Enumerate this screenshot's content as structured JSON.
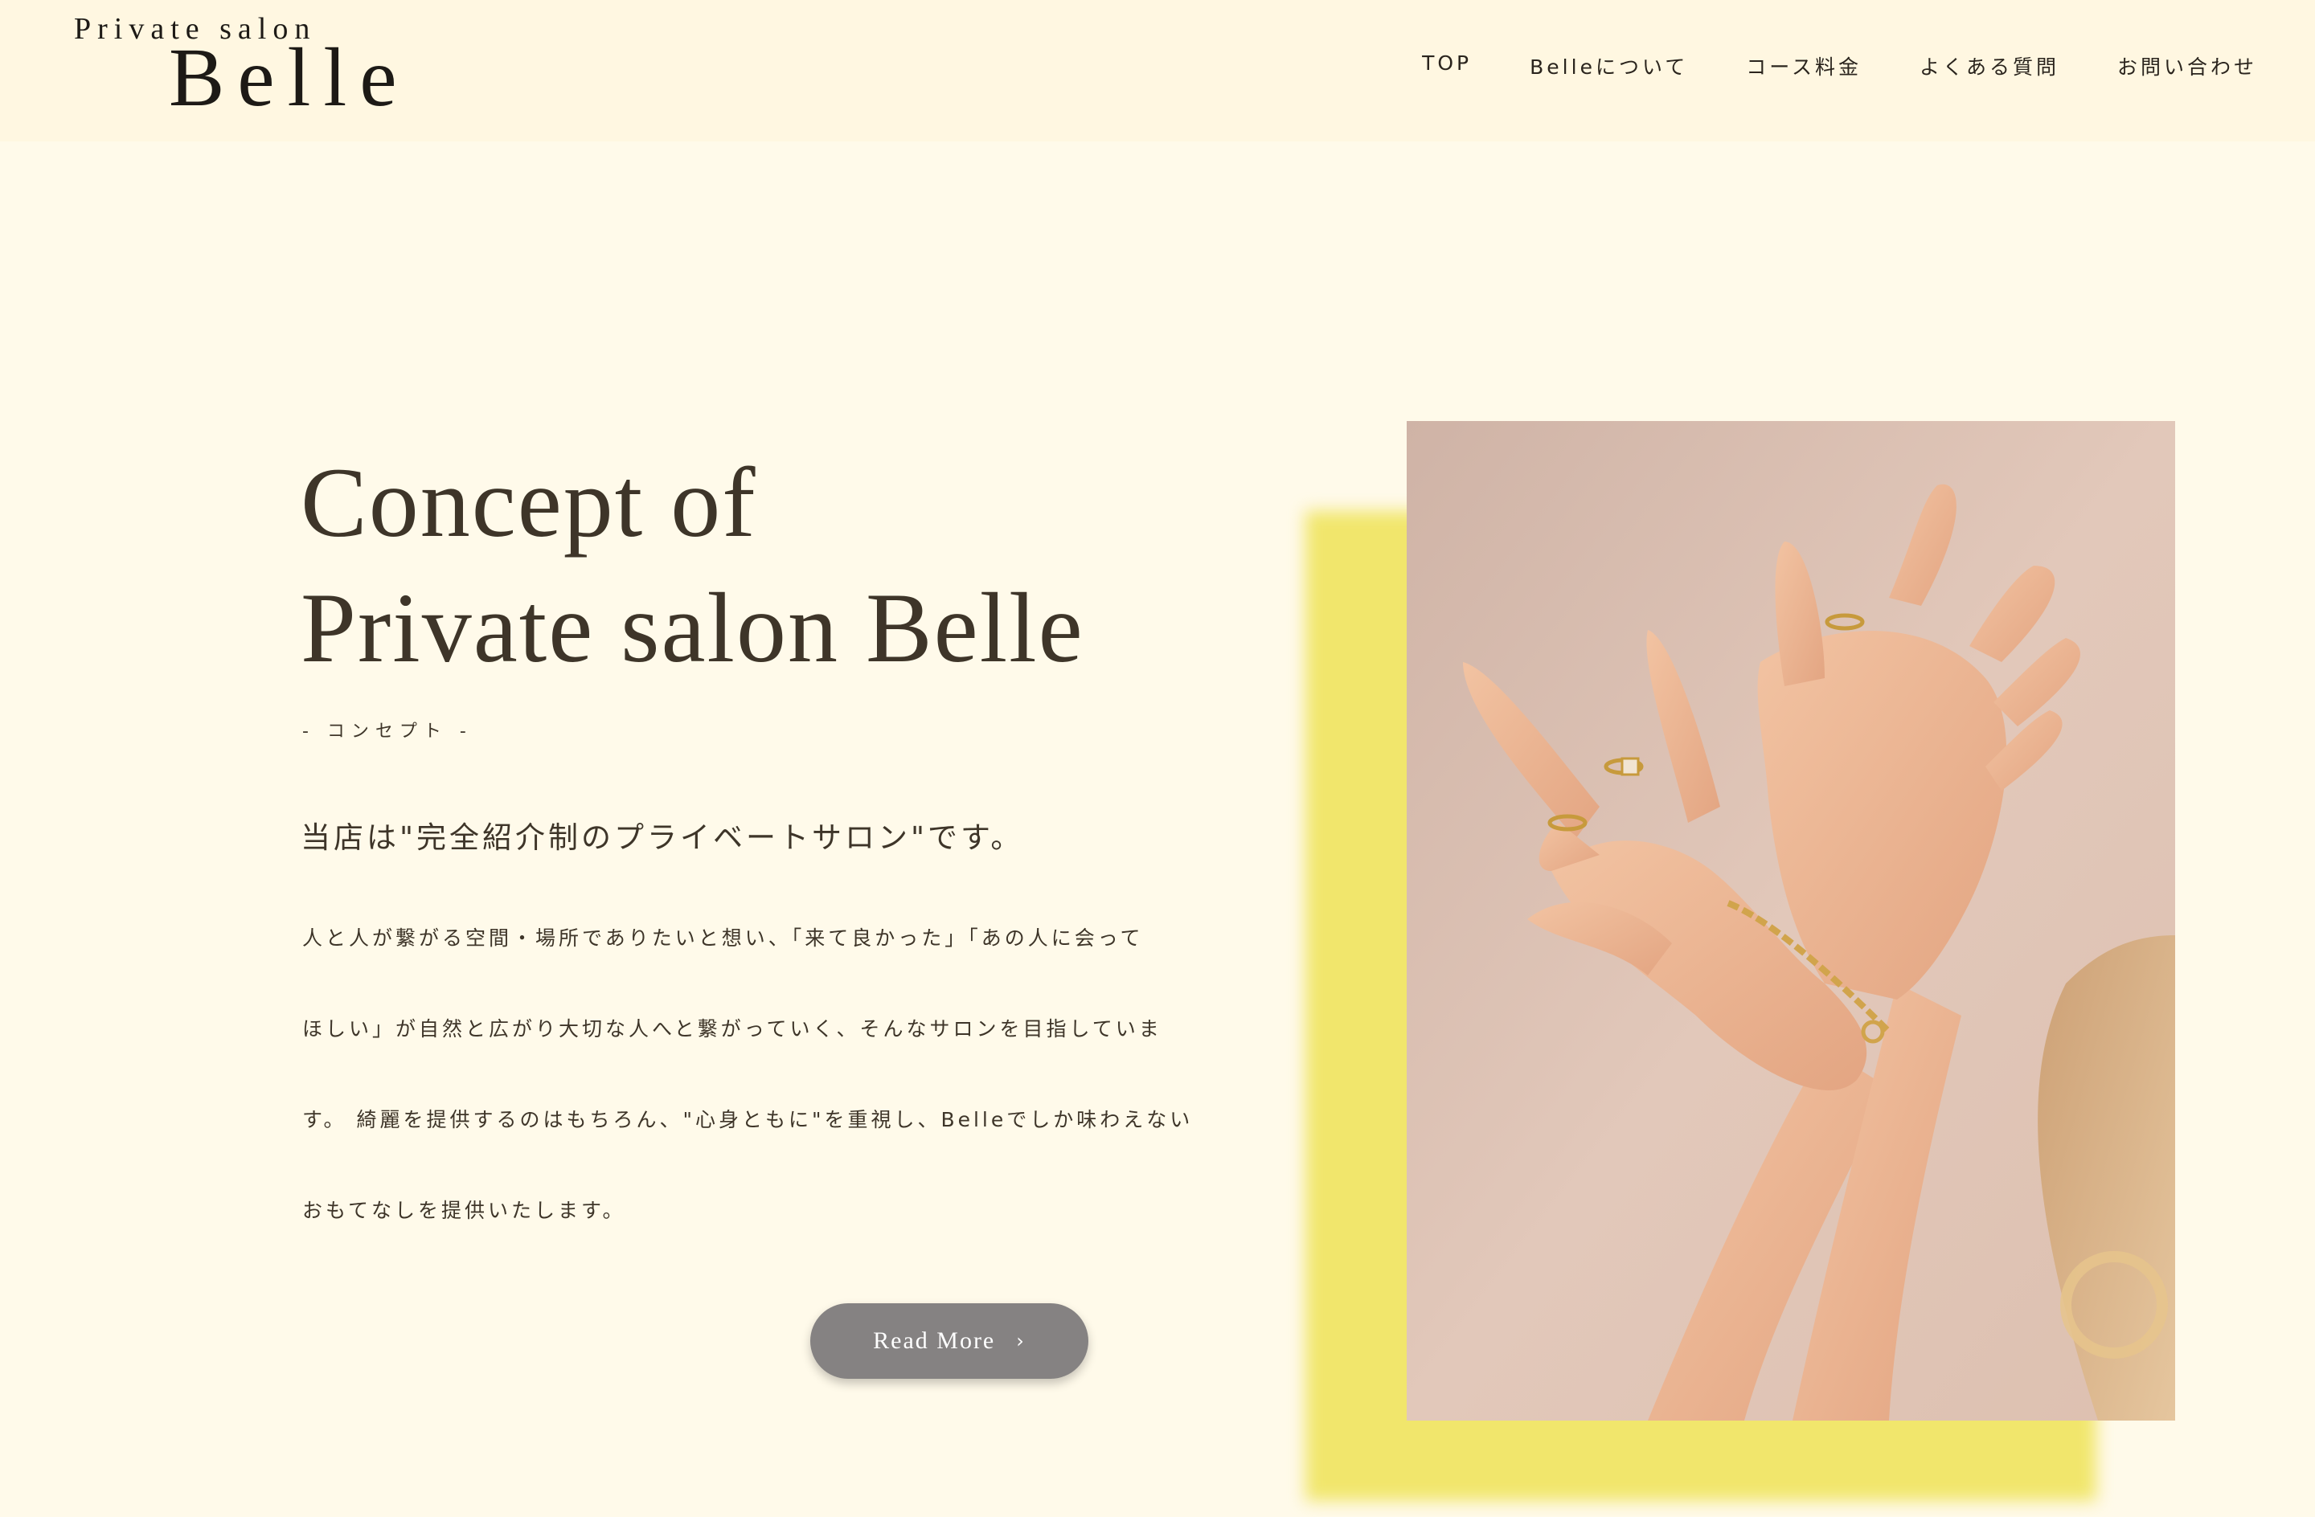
{
  "header": {
    "logo_top": "Private salon",
    "logo_main": "Belle",
    "nav": [
      {
        "label": "TOP"
      },
      {
        "label": "Belleについて"
      },
      {
        "label": "コース料金"
      },
      {
        "label": "よくある質問"
      },
      {
        "label": "お問い合わせ"
      }
    ]
  },
  "concept": {
    "title_line1": "Concept of",
    "title_line2": "Private salon Belle",
    "subtitle": "- コンセプト -",
    "lead": "当店は\"完全紹介制のプライベートサロン\"です。",
    "body_lines": [
      "人と人が繋がる空間・場所でありたいと想い、「来て良かった」「あの人に会って",
      "ほしい」が自然と広がり大切な人へと繋がっていく、そんなサロンを目指していま",
      "す。 綺麗を提供するのはもちろん、\"心身ともに\"を重視し、Belleでしか味わえない",
      "おもてなしを提供いたします。"
    ],
    "button_label": "Read More",
    "button_icon": "chevron-right-icon"
  },
  "photo": {
    "subject": "hands-with-rings-photo"
  },
  "colors": {
    "page_bg": "#fffaea",
    "header_bg": "#fff7e1",
    "text": "#3e3529",
    "accent_yellow": "#f1e66c",
    "button_bg": "#858282"
  }
}
